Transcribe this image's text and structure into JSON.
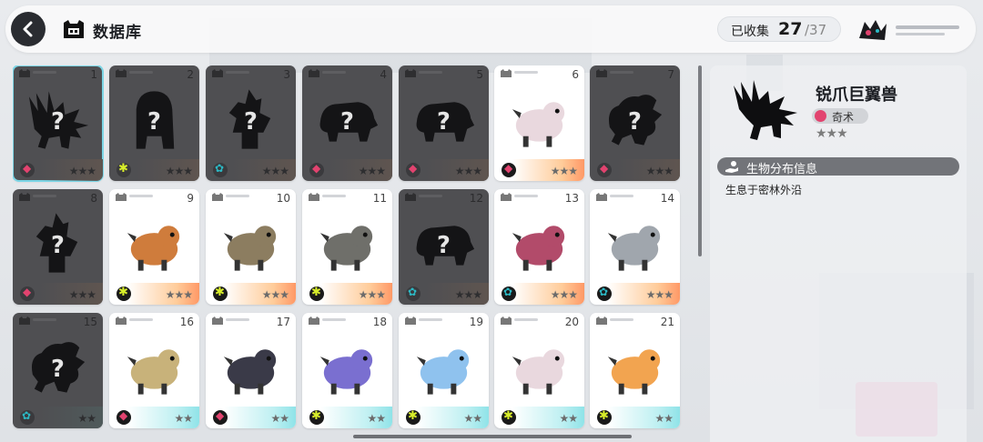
{
  "header": {
    "title": "数据库",
    "collected_label": "已收集",
    "collected_count": "27",
    "collected_total": "/37"
  },
  "cards": [
    {
      "number": "1",
      "locked": true,
      "selected": true,
      "element": "magic",
      "stars": "★★★",
      "glow": "orange"
    },
    {
      "number": "2",
      "locked": true,
      "element": "grass",
      "stars": "★★★",
      "glow": "orange"
    },
    {
      "number": "3",
      "locked": true,
      "element": "flower",
      "stars": "★★★",
      "glow": "orange"
    },
    {
      "number": "4",
      "locked": true,
      "element": "magic",
      "stars": "★★★",
      "glow": "orange"
    },
    {
      "number": "5",
      "locked": true,
      "element": "magic",
      "stars": "★★★",
      "glow": "orange"
    },
    {
      "number": "6",
      "locked": false,
      "element": "magic",
      "stars": "★★★",
      "glow": "orange"
    },
    {
      "number": "7",
      "locked": true,
      "element": "magic",
      "stars": "★★★",
      "glow": "orange"
    },
    {
      "number": "8",
      "locked": true,
      "element": "magic",
      "stars": "★★★",
      "glow": "orange"
    },
    {
      "number": "9",
      "locked": false,
      "element": "grass",
      "stars": "★★★",
      "glow": "orange"
    },
    {
      "number": "10",
      "locked": false,
      "element": "grass",
      "stars": "★★★",
      "glow": "orange"
    },
    {
      "number": "11",
      "locked": false,
      "element": "grass",
      "stars": "★★★",
      "glow": "orange"
    },
    {
      "number": "12",
      "locked": true,
      "element": "flower",
      "stars": "★★★",
      "glow": "orange"
    },
    {
      "number": "13",
      "locked": false,
      "element": "flower",
      "stars": "★★★",
      "glow": "orange"
    },
    {
      "number": "14",
      "locked": false,
      "element": "flower",
      "stars": "★★★",
      "glow": "orange"
    },
    {
      "number": "15",
      "locked": true,
      "element": "flower",
      "stars": "★★",
      "glow": "cyan"
    },
    {
      "number": "16",
      "locked": false,
      "element": "magic",
      "stars": "★★",
      "glow": "cyan"
    },
    {
      "number": "17",
      "locked": false,
      "element": "magic",
      "stars": "★★",
      "glow": "cyan"
    },
    {
      "number": "18",
      "locked": false,
      "element": "grass",
      "stars": "★★",
      "glow": "cyan"
    },
    {
      "number": "19",
      "locked": false,
      "element": "grass",
      "stars": "★★",
      "glow": "cyan"
    },
    {
      "number": "20",
      "locked": false,
      "element": "grass",
      "stars": "★★",
      "glow": "cyan"
    },
    {
      "number": "21",
      "locked": false,
      "element": "grass",
      "stars": "★★",
      "glow": "cyan"
    }
  ],
  "detail": {
    "name": "锐爪巨翼兽",
    "type_label": "奇术",
    "stars": "★★★",
    "section_title": "生物分布信息",
    "habitat": "生息于密林外沿"
  },
  "colors": {
    "magic": "#e2436f",
    "grass": "#d8ee2a",
    "flower": "#2cb8c4",
    "accent_selected": "#7cd6e6"
  }
}
